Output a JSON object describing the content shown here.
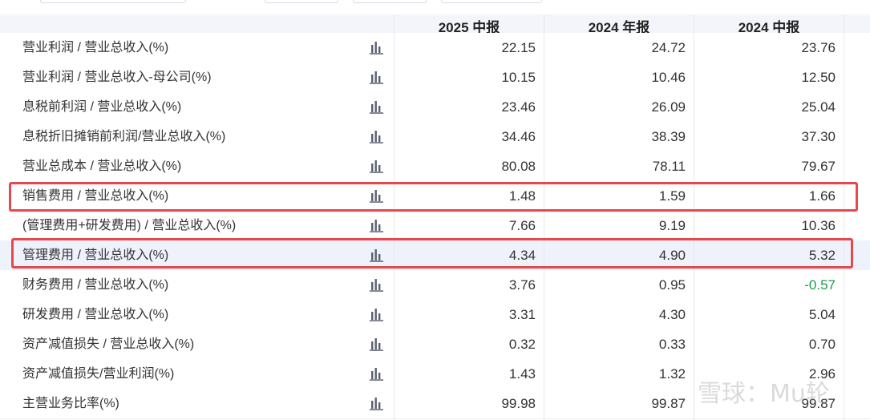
{
  "header": {
    "periods": [
      "2025 中报",
      "2024 年报",
      "2024 中报"
    ]
  },
  "rows": [
    {
      "label": "营业利润 / 营业总收入(%)",
      "values": [
        "22.15",
        "24.72",
        "23.76"
      ]
    },
    {
      "label": "营业利润 / 营业总收入-母公司(%)",
      "values": [
        "10.15",
        "10.46",
        "12.50"
      ]
    },
    {
      "label": "息税前利润 / 营业总收入(%)",
      "values": [
        "23.46",
        "26.09",
        "25.04"
      ]
    },
    {
      "label": "息税折旧摊销前利润/营业总收入(%)",
      "values": [
        "34.46",
        "38.39",
        "37.30"
      ]
    },
    {
      "label": "营业总成本 / 营业总收入(%)",
      "values": [
        "80.08",
        "78.11",
        "79.67"
      ]
    },
    {
      "label": "销售费用 / 营业总收入(%)",
      "values": [
        "1.48",
        "1.59",
        "1.66"
      ]
    },
    {
      "label": "(管理费用+研发费用) / 营业总收入(%)",
      "values": [
        "7.66",
        "9.19",
        "10.36"
      ]
    },
    {
      "label": "管理费用 / 营业总收入(%)",
      "values": [
        "4.34",
        "4.90",
        "5.32"
      ]
    },
    {
      "label": "财务费用 / 营业总收入(%)",
      "values": [
        "3.76",
        "0.95",
        "-0.57"
      ]
    },
    {
      "label": "研发费用 / 营业总收入(%)",
      "values": [
        "3.31",
        "4.30",
        "5.04"
      ]
    },
    {
      "label": "资产减值损失 / 营业总收入(%)",
      "values": [
        "0.32",
        "0.33",
        "0.70"
      ]
    },
    {
      "label": "资产减值损失/营业利润(%)",
      "values": [
        "1.43",
        "1.32",
        "2.96"
      ]
    },
    {
      "label": "主营业务比率(%)",
      "values": [
        "99.98",
        "99.87",
        "99.87"
      ]
    }
  ],
  "highlighted_rows": [
    5,
    7
  ],
  "row_chart_icon": "bar-chart-icon",
  "colors": {
    "header_bg": "#f3f5fa",
    "highlight_row_bg": "#eef2fb",
    "annotation_box": "#e5484d",
    "negative_value": "#1a9c49"
  },
  "watermark": "雪球：Mu轮"
}
